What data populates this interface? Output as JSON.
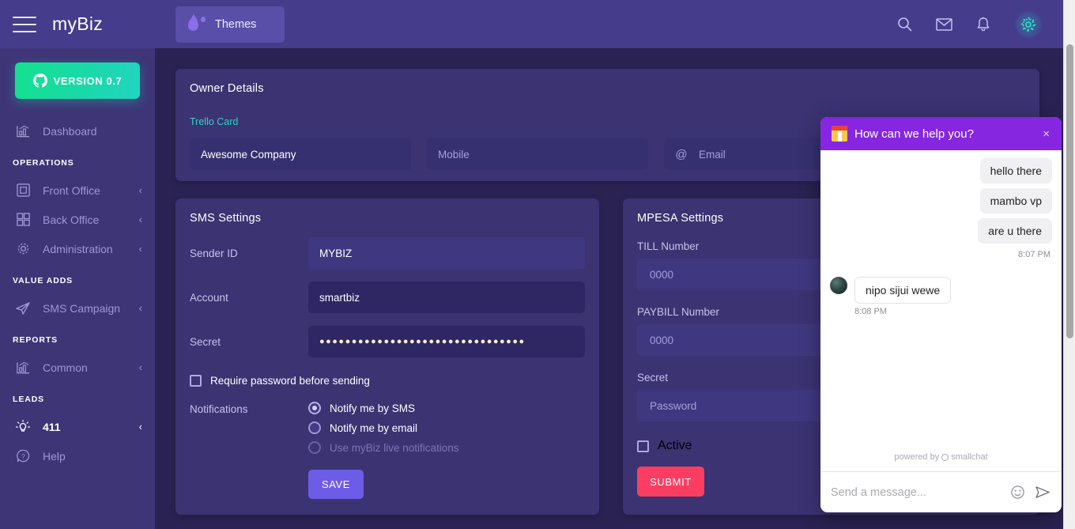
{
  "topbar": {
    "menu_icon": "hamburger-icon",
    "brand": "myBiz",
    "themes_label": "Themes",
    "themes_icon": "droplet-icon",
    "icons": [
      "search-icon",
      "envelope-icon",
      "bell-icon",
      "gear-icon"
    ],
    "accent_bg": "#453c8c",
    "themes_btn_bg": "#594fa8"
  },
  "sidebar": {
    "version_label": "VERSION 0.7",
    "version_icon": "github-icon",
    "version_gradient_start": "#13e08f",
    "version_gradient_end": "#22d3c0",
    "bg": "#3e3577",
    "items": [
      {
        "type": "item",
        "label": "Dashboard",
        "icon": "chart-bar-icon",
        "chevron": "",
        "active": false
      },
      {
        "type": "section",
        "label": "OPERATIONS"
      },
      {
        "type": "item",
        "label": "Front Office",
        "icon": "window-icon",
        "chevron": "‹",
        "active": false
      },
      {
        "type": "item",
        "label": "Back Office",
        "icon": "grid-icon",
        "chevron": "‹",
        "active": false
      },
      {
        "type": "item",
        "label": "Administration",
        "icon": "gear-icon",
        "chevron": "‹",
        "active": false
      },
      {
        "type": "section",
        "label": "VALUE ADDS"
      },
      {
        "type": "item",
        "label": "SMS Campaign",
        "icon": "paper-plane-icon",
        "chevron": "‹",
        "active": false
      },
      {
        "type": "section",
        "label": "REPORTS"
      },
      {
        "type": "item",
        "label": "Common",
        "icon": "chart-bar-icon",
        "chevron": "‹",
        "active": false
      },
      {
        "type": "section",
        "label": "LEADS"
      },
      {
        "type": "item",
        "label": "411",
        "icon": "lightbulb-icon",
        "chevron": "‹",
        "active": true
      },
      {
        "type": "item",
        "label": "Help",
        "icon": "question-circle-icon",
        "chevron": "",
        "active": false
      }
    ]
  },
  "owner": {
    "title": "Owner Details",
    "trello_link": "Trello Card",
    "trello_color": "#28d6c8",
    "company_value": "Awesome Company",
    "mobile_placeholder": "Mobile",
    "email_placeholder": "Email",
    "email_icon": "at-icon"
  },
  "sms": {
    "title": "SMS Settings",
    "sender_id_label": "Sender ID",
    "sender_id_value": "MYBIZ",
    "account_label": "Account",
    "account_value": "smartbiz",
    "secret_label": "Secret",
    "secret_value": "●●●●●●●●●●●●●●●●●●●●●●●●●●●●●●●●",
    "require_password_label": "Require password before sending",
    "require_password_checked": false,
    "notifications_label": "Notifications",
    "radio_options": [
      {
        "label": "Notify me by SMS",
        "selected": true,
        "disabled": false
      },
      {
        "label": "Notify me by email",
        "selected": false,
        "disabled": false
      },
      {
        "label": "Use myBiz live notifications",
        "selected": false,
        "disabled": true
      }
    ],
    "save_label": "SAVE",
    "save_color": "#6c5ce7"
  },
  "mpesa": {
    "title": "MPESA Settings",
    "till_label": "TILL Number",
    "till_placeholder": "0000",
    "paybill_label": "PAYBILL Number",
    "paybill_placeholder": "0000",
    "secret_label": "Secret",
    "secret_placeholder": "Password",
    "active_label": "Active",
    "active_checked": false,
    "submit_label": "SUBMIT",
    "submit_color": "#fc3d62"
  },
  "chat": {
    "header_title": "How can we help you?",
    "header_icon": "popcorn-emoji-icon",
    "header_bg": "#8626e0",
    "close_label": "×",
    "outgoing_messages": [
      "hello there",
      "mambo vp",
      "are u there"
    ],
    "outgoing_timestamp": "8:07 PM",
    "incoming_message": "nipo sijui wewe",
    "incoming_timestamp": "8:08 PM",
    "avatar_icon": "user-avatar",
    "powered_prefix": "powered by",
    "powered_brand": "smallchat",
    "input_placeholder": "Send a message...",
    "emoji_icon": "smiley-icon",
    "send_icon": "send-arrow-icon"
  }
}
